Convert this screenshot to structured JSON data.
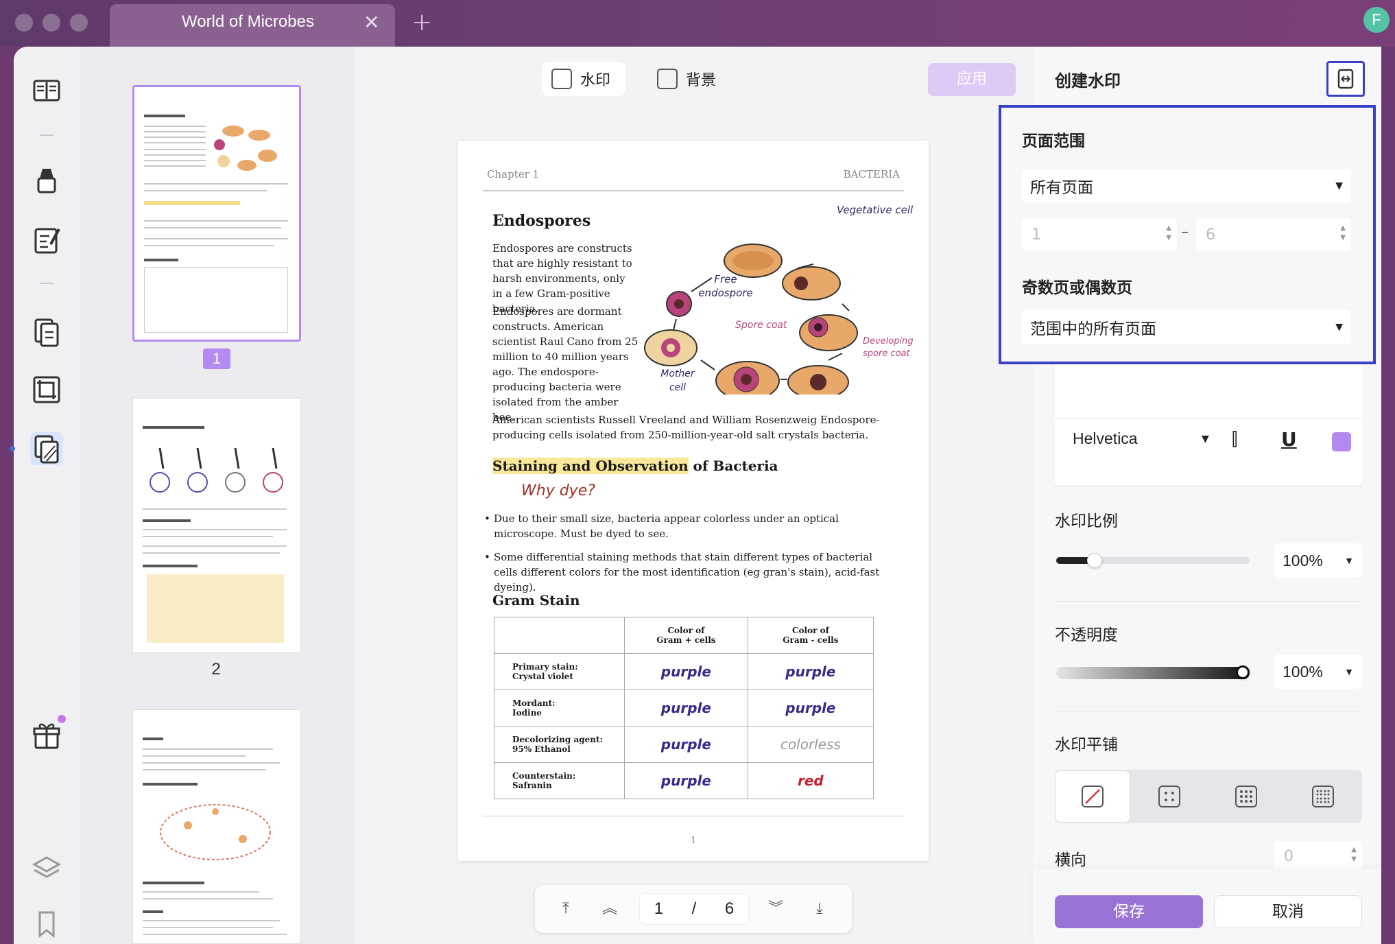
{
  "tab": {
    "title": "World of Microbes",
    "close": "✕",
    "add": "+"
  },
  "user": {
    "avatar_letter": "F"
  },
  "toolbar": {
    "watermark_label": "水印",
    "background_label": "背景",
    "apply_label": "应用"
  },
  "thumbnails": [
    {
      "number": "1",
      "selected": true
    },
    {
      "number": "2",
      "selected": false
    },
    {
      "number": "",
      "selected": false
    }
  ],
  "document": {
    "header_left": "Chapter 1",
    "header_right": "BACTERIA",
    "section1_title": "Endospores",
    "para1": "Endospores are constructs that are highly resistant to harsh environments, only in a few Gram-positive bacteria.",
    "para2": "Endospores are dormant constructs. American scientist Raul Cano from 25 million to 40 million years ago. The endospore-producing bacteria were isolated from the amber bee.",
    "para3": "American scientists Russell Vreeland and William Rosenzweig Endospore-producing cells isolated from 250-million-year-old salt crystals bacteria.",
    "diagram_labels": {
      "vegetative": "Vegetative cell",
      "free": "Free endospore",
      "spore_coat": "Spore coat",
      "developing": "Developing spore coat",
      "mother": "Mother cell"
    },
    "section2_title_highlight": "Staining and Observation",
    "section2_title_rest": " of Bacteria",
    "why_dye": "Why dye?",
    "bullet1": "Due to their small size, bacteria appear colorless under an optical microscope. Must be dyed to see.",
    "bullet2": "Some differential staining methods that stain different types of bacterial cells different colors for the most identification (eg gran's stain), acid-fast dyeing).",
    "section3_title": "Gram Stain",
    "table": {
      "col1": "Color of\nGram + cells",
      "col2": "Color of\nGram - cells",
      "rows": [
        {
          "label": "Primary stain:\nCrystal violet",
          "pos": "purple",
          "neg": "purple"
        },
        {
          "label": "Mordant:\nIodine",
          "pos": "purple",
          "neg": "purple"
        },
        {
          "label": "Decolorizing agent:\n95% Ethanol",
          "pos": "purple",
          "neg": "colorless"
        },
        {
          "label": "Counterstain:\nSafranin",
          "pos": "purple",
          "neg": "red"
        }
      ]
    },
    "page_number": "1"
  },
  "pager": {
    "current": "1",
    "separator": "/",
    "total": "6"
  },
  "panel": {
    "title": "创建水印",
    "page_range_label": "页面范围",
    "page_range_value": "所有页面",
    "range_from": "1",
    "range_dash": "–",
    "range_to": "6",
    "odd_even_label": "奇数页或偶数页",
    "odd_even_value": "范围中的所有页面",
    "font_name": "Helvetica",
    "font_color": "#b58af0",
    "scale_label": "水印比例",
    "scale_value": "100%",
    "scale_level": 0.2,
    "opacity_label": "不透明度",
    "opacity_value": "100%",
    "opacity_level": 1.0,
    "tile_label": "水印平铺",
    "horizontal_label": "横向",
    "horizontal_value": "0",
    "save_label": "保存",
    "cancel_label": "取消"
  },
  "colors": {
    "accent": "#b58af0",
    "highlight_border": "#3a3fc4",
    "save_button": "#9a73d6"
  }
}
